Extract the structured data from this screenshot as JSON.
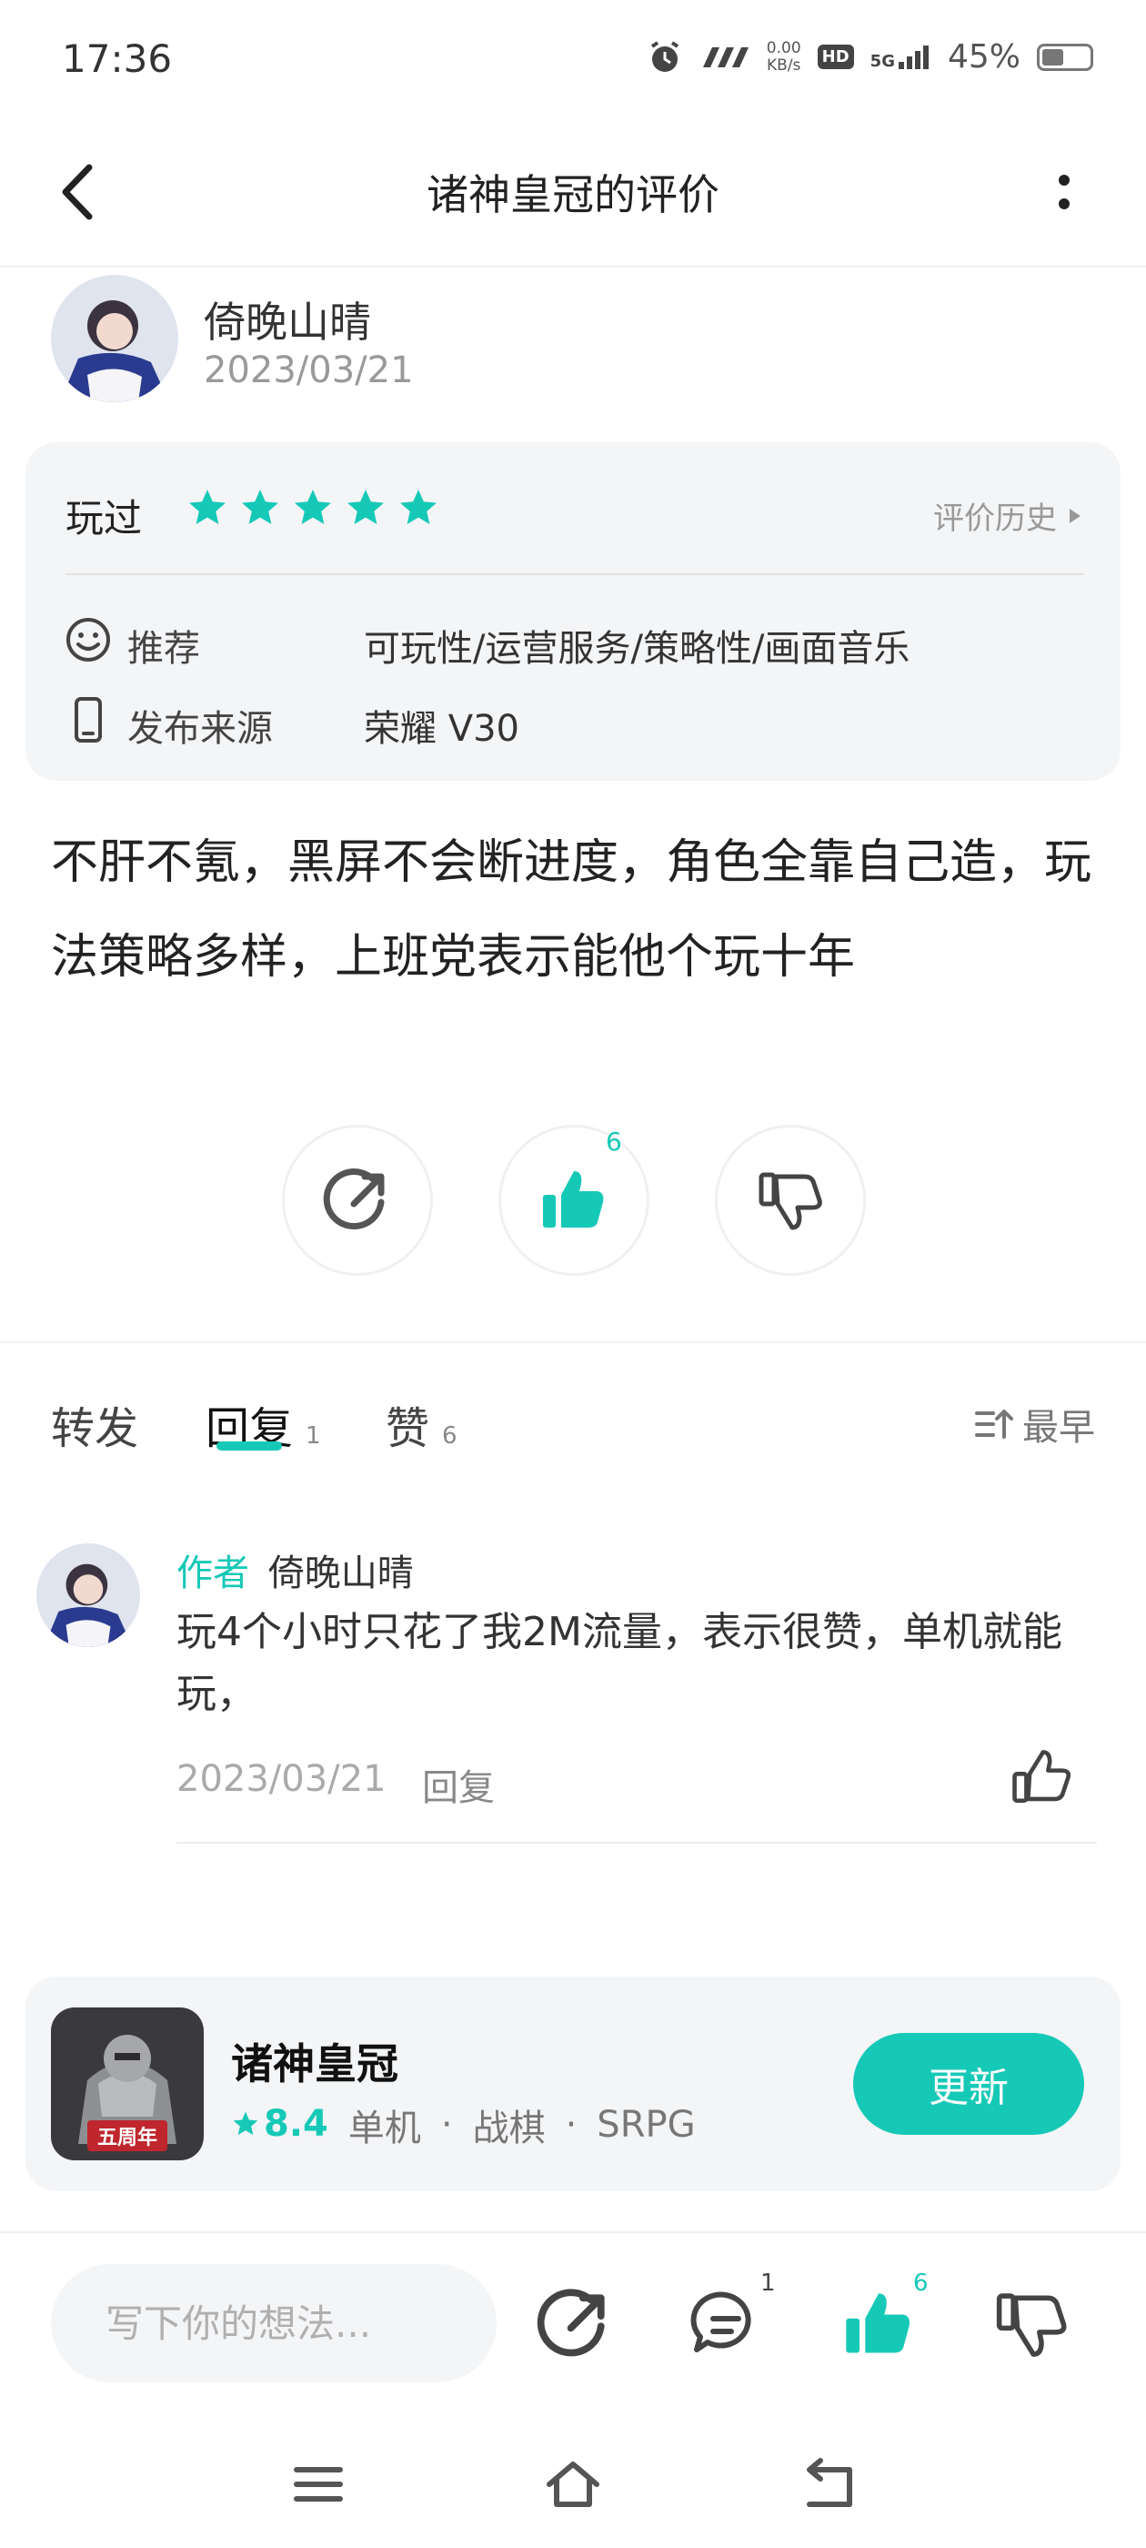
{
  "status_bar": {
    "time": "17:36",
    "net_speed_value": "0.00",
    "net_speed_unit": "KB/s",
    "hd": "HD",
    "signal": "5G",
    "battery": "45%",
    "battery_level": 0.45
  },
  "header": {
    "title": "诸神皇冠的评价"
  },
  "author": {
    "name": "倚晚山晴",
    "date": "2023/03/21"
  },
  "info_card": {
    "played_label": "玩过",
    "rating_stars": 5,
    "history_link": "评价历史",
    "recommend_label": "推荐",
    "recommend_value": "可玩性/运营服务/策略性/画面音乐",
    "source_label": "发布来源",
    "source_value": "荣耀 V30"
  },
  "review": {
    "text": "不肝不氪，黑屏不会断进度，角色全靠自己造，玩法策略多样，上班党表示能他个玩十年"
  },
  "actions": {
    "like_count": "6"
  },
  "tabs": {
    "forward": "转发",
    "reply": "回复",
    "reply_count": "1",
    "likes": "赞",
    "likes_count": "6",
    "sort_label": "最早"
  },
  "reply": {
    "author_tag": "作者",
    "name": "倚晚山晴",
    "text": "玩4个小时只花了我2M流量，表示很赞，单机就能玩，",
    "date": "2023/03/21",
    "reply_button": "回复"
  },
  "game": {
    "name": "诸神皇冠",
    "score": "8.4",
    "tags": [
      "单机",
      "战棋",
      "SRPG"
    ],
    "separator": "·",
    "update_button": "更新",
    "icon_badge": "五周年"
  },
  "bottom_bar": {
    "placeholder": "写下你的想法...",
    "comment_count": "1",
    "like_count": "6"
  },
  "colors": {
    "accent": "#16c9b7",
    "card_bg": "#f4f5f7"
  }
}
